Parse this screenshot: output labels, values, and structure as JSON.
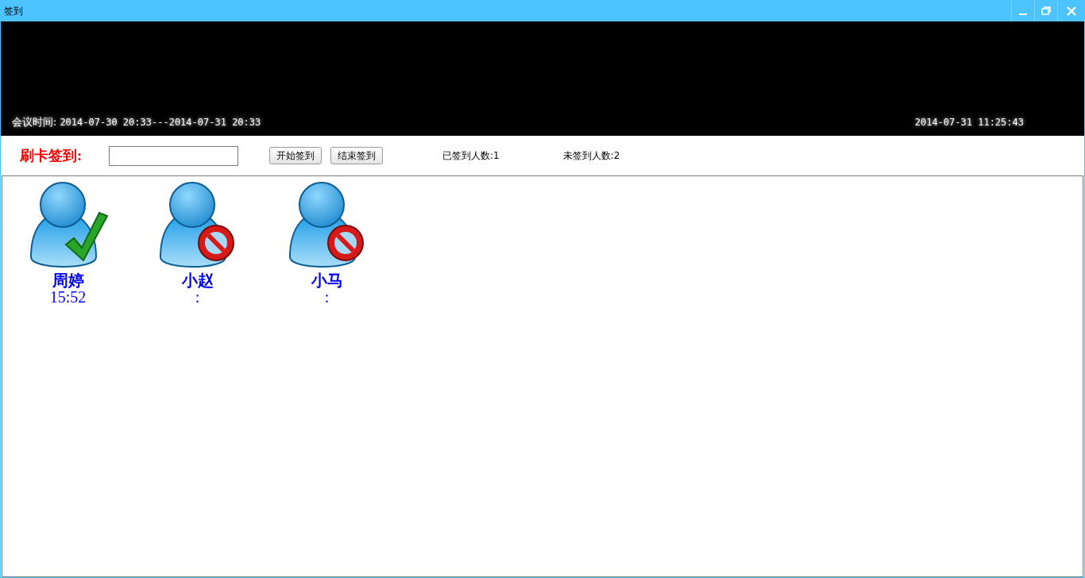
{
  "window": {
    "title": "签到"
  },
  "banner": {
    "meeting_time_label": "会议时间:",
    "meeting_time": "2014-07-30 20:33---2014-07-31 20:33",
    "clock": "2014-07-31 11:25:43"
  },
  "toolbar": {
    "card_label": "刷卡签到:",
    "buttons": [
      "开始签到",
      "结束签到"
    ],
    "signed_count": "已签到人数:1",
    "unsigned_count": "未签到人数:2"
  },
  "attendees": [
    {
      "name": "周婷",
      "time": "15:52",
      "signed_in": true
    },
    {
      "name": "小赵",
      "time": ":",
      "signed_in": false
    },
    {
      "name": "小马",
      "time": ":",
      "signed_in": false
    }
  ]
}
